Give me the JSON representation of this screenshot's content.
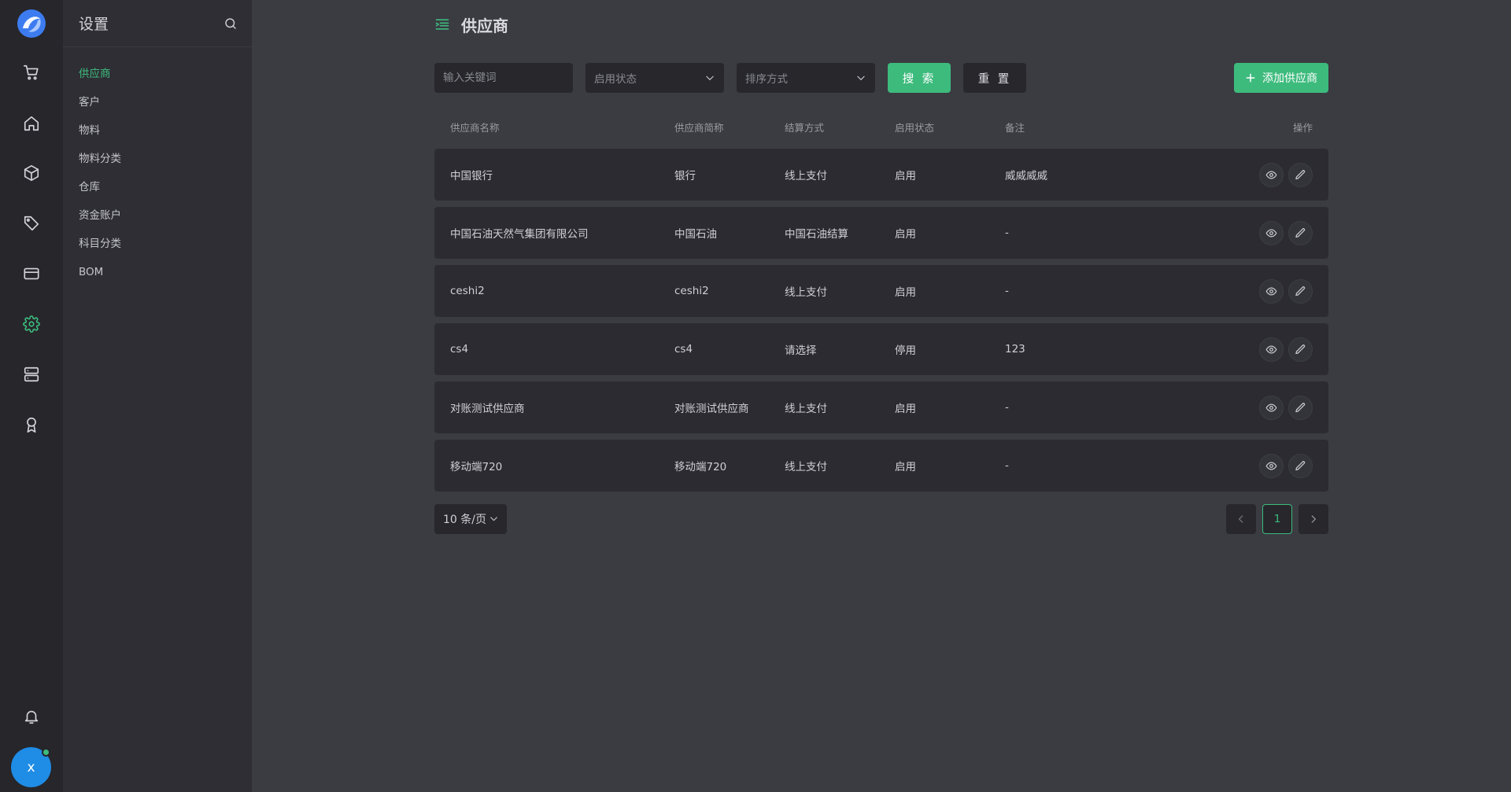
{
  "sidebar": {
    "title": "设置",
    "items": [
      {
        "label": "供应商",
        "active": true
      },
      {
        "label": "客户"
      },
      {
        "label": "物料"
      },
      {
        "label": "物料分类"
      },
      {
        "label": "仓库"
      },
      {
        "label": "资金账户"
      },
      {
        "label": "科目分类"
      },
      {
        "label": "BOM"
      }
    ]
  },
  "rail": {
    "icons": [
      "cart-icon",
      "home-icon",
      "box-icon",
      "tag-icon",
      "card-icon",
      "gear-icon",
      "server-icon",
      "award-icon"
    ],
    "active_icon": "gear-icon",
    "notification_icon": "bell-icon",
    "avatar_letter": "x"
  },
  "page": {
    "title": "供应商"
  },
  "filters": {
    "keyword_placeholder": "输入关键词",
    "status_placeholder": "启用状态",
    "sort_placeholder": "排序方式",
    "search_label": "搜 索",
    "reset_label": "重 置",
    "add_label": "添加供应商"
  },
  "table": {
    "columns": {
      "name": "供应商名称",
      "short": "供应商简称",
      "settle": "结算方式",
      "status": "启用状态",
      "note": "备注",
      "ops": "操作"
    },
    "rows": [
      {
        "name": "中国银行",
        "short": "银行",
        "settle": "线上支付",
        "status": "启用",
        "note": "威威威威"
      },
      {
        "name": "中国石油天然气集团有限公司",
        "short": "中国石油",
        "settle": "中国石油结算",
        "status": "启用",
        "note": "-"
      },
      {
        "name": "ceshi2",
        "short": "ceshi2",
        "settle": "线上支付",
        "status": "启用",
        "note": "-"
      },
      {
        "name": "cs4",
        "short": "cs4",
        "settle": "请选择",
        "status": "停用",
        "note": "123"
      },
      {
        "name": "对账测试供应商",
        "short": "对账测试供应商",
        "settle": "线上支付",
        "status": "启用",
        "note": "-"
      },
      {
        "name": "移动端720",
        "short": "移动端720",
        "settle": "线上支付",
        "status": "启用",
        "note": "-"
      }
    ]
  },
  "pagination": {
    "page_size_label": "10 条/页",
    "current_page": "1"
  },
  "colors": {
    "accent": "#3dbb7d",
    "background": "#3b3b42",
    "rail": "#26262b",
    "sidebar": "#2e2e34",
    "row": "#2b2b31",
    "avatar": "#1f8ce6"
  }
}
